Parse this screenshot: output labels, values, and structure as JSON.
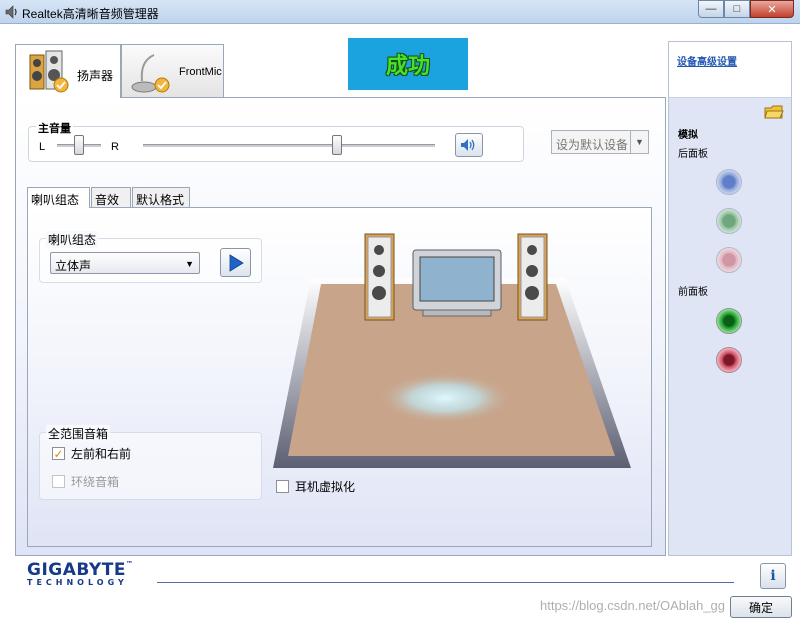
{
  "window": {
    "title": "Realtek高清晰音频管理器",
    "controls": {
      "minimize": "—",
      "maximize": "□",
      "close": "✕"
    }
  },
  "device_tabs": [
    {
      "label": "扬声器",
      "icon": "speaker-icon",
      "active": true
    },
    {
      "label": "FrontMic",
      "icon": "microphone-icon",
      "active": false
    }
  ],
  "banner": {
    "text": "成功",
    "bg_color": "#1aa3df",
    "text_color": "#45e32a"
  },
  "main_volume": {
    "label": "主音量",
    "left_label": "L",
    "right_label": "R",
    "balance_level": 0.5,
    "volume_level": 0.66
  },
  "default_device": {
    "label": "设为默认设备"
  },
  "sub_tabs": [
    {
      "label": "喇叭组态",
      "active": true
    },
    {
      "label": "音效",
      "active": false
    },
    {
      "label": "默认格式",
      "active": false
    }
  ],
  "speaker_config": {
    "group_label": "喇叭组态",
    "selected": "立体声"
  },
  "full_range": {
    "group_label": "全范围音箱",
    "options": [
      {
        "label": "左前和右前",
        "checked": true,
        "enabled": true
      },
      {
        "label": "环绕音箱",
        "checked": false,
        "enabled": false
      }
    ]
  },
  "headphone_virtualization": {
    "label": "耳机虚拟化",
    "checked": false
  },
  "side_panel": {
    "advanced_link": "设备高级设置",
    "section": "模拟",
    "back_panel_label": "后面板",
    "front_panel_label": "前面板",
    "back_jacks": [
      {
        "color": "#6e8fd8",
        "state": "empty"
      },
      {
        "color": "#7fb48a",
        "state": "empty"
      },
      {
        "color": "#d7a0ae",
        "state": "empty"
      }
    ],
    "front_jacks": [
      {
        "color": "#1e8f2a",
        "state": "plugged"
      },
      {
        "color": "#d2586f",
        "state": "plugged"
      }
    ]
  },
  "footer": {
    "brand": "GIGABYTE",
    "brand_sub": "TECHNOLOGY",
    "ok_label": "确定",
    "info_label": "i",
    "watermark": "https://blog.csdn.net/OAblah_gg"
  }
}
